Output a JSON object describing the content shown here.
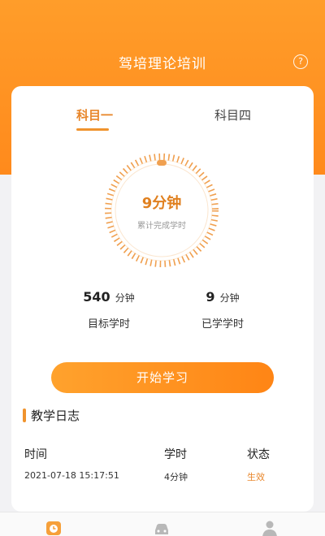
{
  "header": {
    "title": "驾培理论培训"
  },
  "tabs": [
    {
      "label": "科目一",
      "active": true
    },
    {
      "label": "科目四",
      "active": false
    }
  ],
  "dial": {
    "value": "9分钟",
    "label": "累计完成学时"
  },
  "stats": {
    "target": {
      "number": "540",
      "unit": "分钟",
      "label": "目标学时"
    },
    "learned": {
      "number": "9",
      "unit": "分钟",
      "label": "已学学时"
    }
  },
  "start_button": {
    "label": "开始学习"
  },
  "log": {
    "title": "教学日志",
    "headers": {
      "time": "时间",
      "hours": "学时",
      "status": "状态"
    },
    "rows": [
      {
        "time": "2021-07-18 15:17:51",
        "hours": "4分钟",
        "status": "生效"
      }
    ]
  },
  "nav": [
    {
      "icon": "clock-icon",
      "active": true
    },
    {
      "icon": "car-icon",
      "active": false
    },
    {
      "icon": "person-icon",
      "active": false
    }
  ],
  "colors": {
    "accent": "#ff8a1c",
    "accent_text": "#e8862a"
  }
}
